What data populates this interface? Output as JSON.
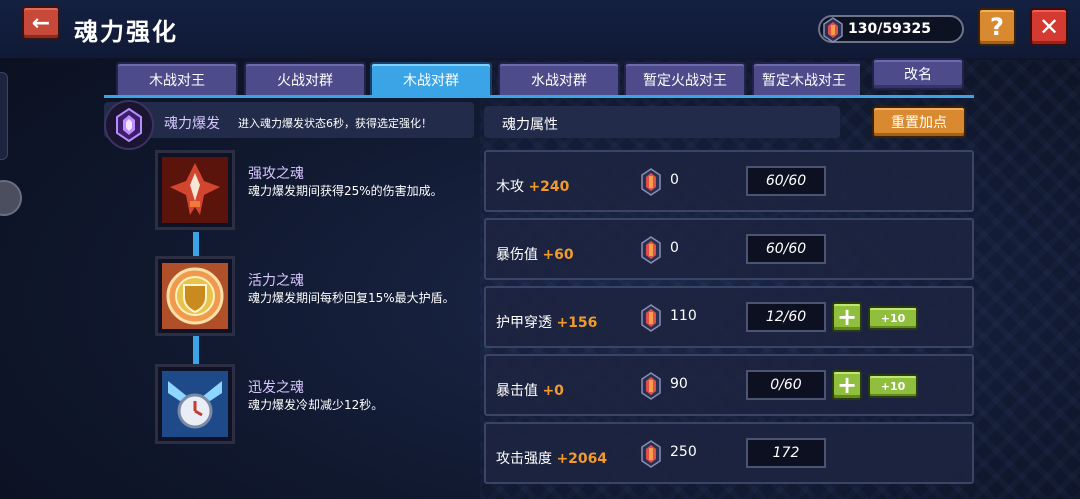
{
  "header": {
    "title": "魂力强化",
    "currency": "130/59325",
    "back_glyph": "←",
    "help_glyph": "?",
    "close_glyph": "✕"
  },
  "tabs": [
    {
      "label": "木战对王",
      "active": false
    },
    {
      "label": "火战对群",
      "active": false
    },
    {
      "label": "木战对群",
      "active": true
    },
    {
      "label": "水战对群",
      "active": false
    },
    {
      "label": "暂定火战对王",
      "active": false
    },
    {
      "label": "暂定木战对王",
      "active": false
    }
  ],
  "rename_label": "改名",
  "burst": {
    "title": "魂力爆发",
    "desc": "进入魂力爆发状态6秒，获得选定强化！"
  },
  "skills": [
    {
      "name": "强攻之魂",
      "desc": "魂力爆发期间获得25%的伤害加成。",
      "icon": "attack-soul-icon"
    },
    {
      "name": "活力之魂",
      "desc": "魂力爆发期间每秒回复15%最大护盾。",
      "icon": "shield-soul-icon"
    },
    {
      "name": "迅发之魂",
      "desc": "魂力爆发冷却减少12秒。",
      "icon": "cooldown-soul-icon"
    }
  ],
  "attributes_panel": {
    "title": "魂力属性",
    "reset_label": "重置加点"
  },
  "attributes": [
    {
      "label": "木攻",
      "bonus": "+240",
      "cost": "0",
      "level": "60/60",
      "upgradable": false
    },
    {
      "label": "暴伤值",
      "bonus": "+60",
      "cost": "0",
      "level": "60/60",
      "upgradable": false
    },
    {
      "label": "护甲穿透",
      "bonus": "+156",
      "cost": "110",
      "level": "12/60",
      "upgradable": true
    },
    {
      "label": "暴击值",
      "bonus": "+0",
      "cost": "90",
      "level": "0/60",
      "upgradable": true
    },
    {
      "label": "攻击强度",
      "bonus": "+2064",
      "cost": "250",
      "level": "172",
      "upgradable": false
    }
  ],
  "plus_label": "+",
  "plus10_label": "+10",
  "colors": {
    "accent": "#3aa4e6",
    "bonus": "#f19a2e",
    "tab": "#4d4b8a",
    "orange_button": "#d98930",
    "red_button": "#d23a32",
    "green_button": "#8fbf3c"
  }
}
